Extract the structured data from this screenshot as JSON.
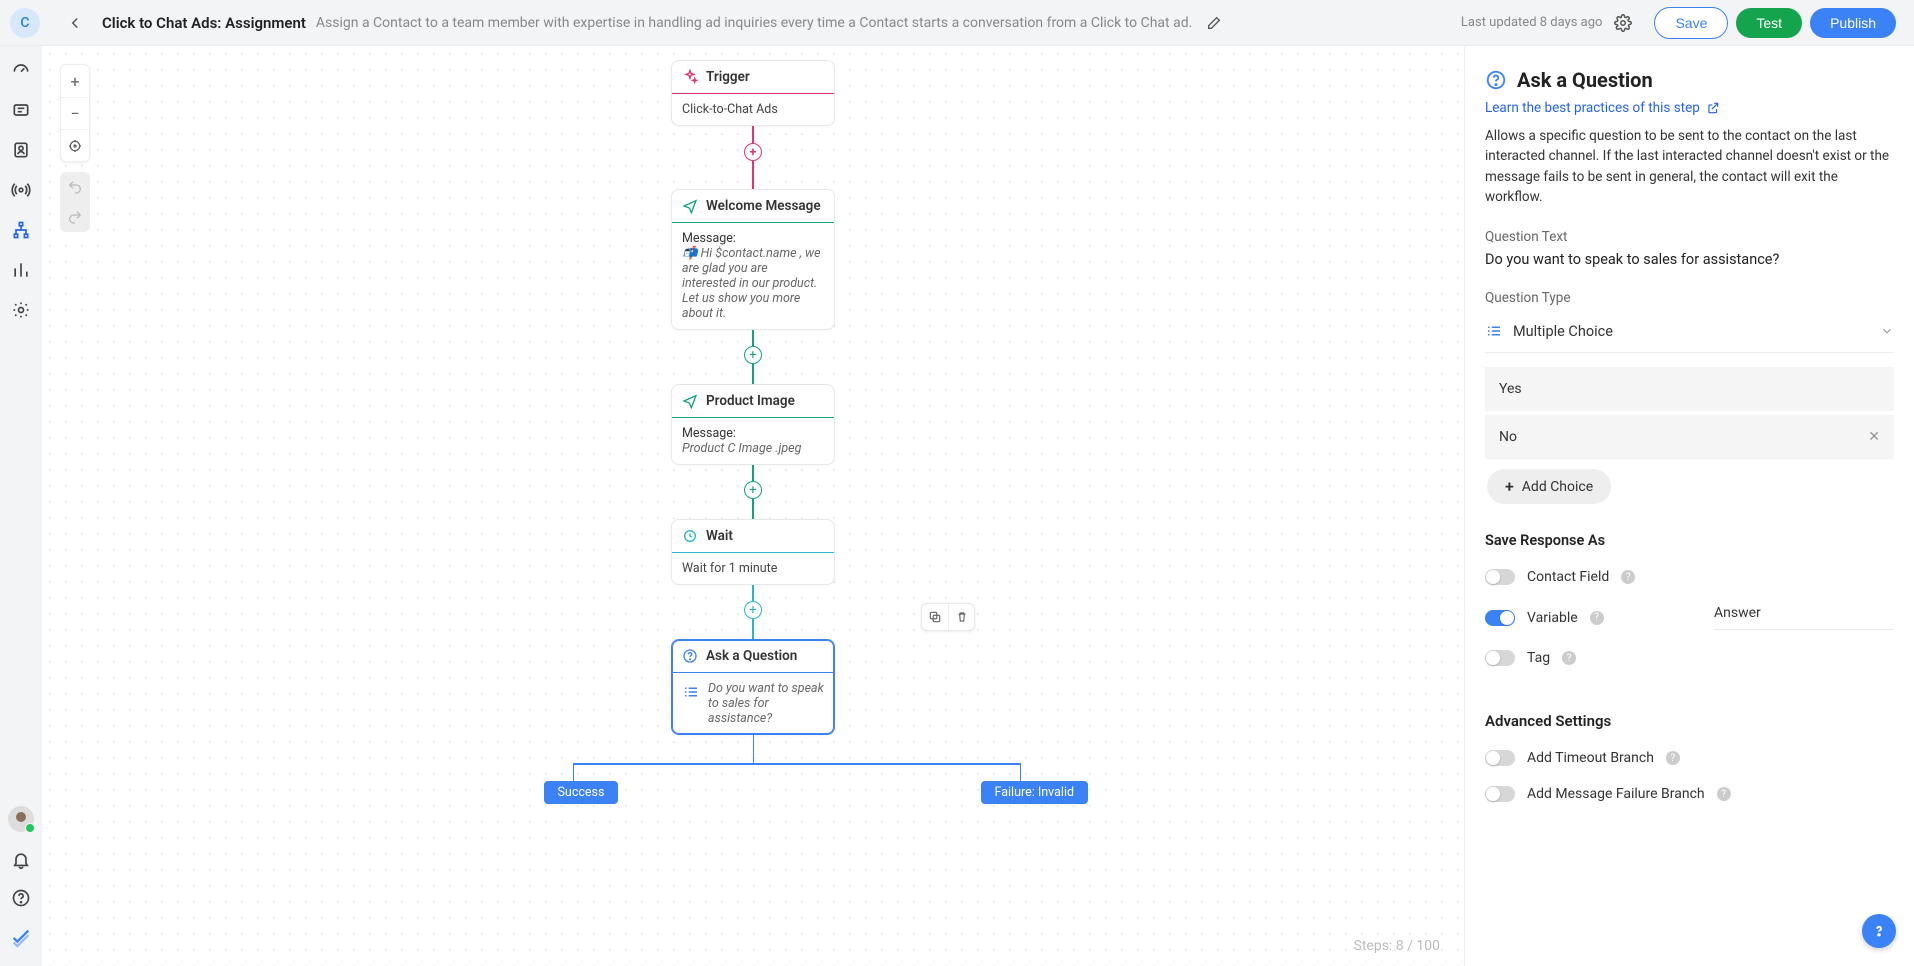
{
  "header": {
    "avatar_letter": "C",
    "title": "Click to Chat Ads: Assignment",
    "subtitle": "Assign a Contact to a team member with expertise in handling ad inquiries every time a Contact starts a conversation from a Click to Chat ad.",
    "last_updated": "Last updated 8 days ago",
    "save_label": "Save",
    "test_label": "Test",
    "publish_label": "Publish"
  },
  "flow": {
    "trigger": {
      "title": "Trigger",
      "body": "Click-to-Chat Ads"
    },
    "welcome": {
      "title": "Welcome Message",
      "label": "Message:",
      "body": "📬 Hi $contact.name , we are glad you are interested in our product. Let us show you more about it."
    },
    "product": {
      "title": "Product Image",
      "label": "Message:",
      "body": "Product C Image .jpeg"
    },
    "wait": {
      "title": "Wait",
      "body": "Wait for 1 minute"
    },
    "question": {
      "title": "Ask a Question",
      "body": "Do you want to speak to sales for assistance?"
    },
    "branches": {
      "success": "Success",
      "failure": "Failure: Invalid"
    },
    "steps_counter": "Steps: 8 / 100"
  },
  "panel": {
    "title": "Ask a Question",
    "learn_link": "Learn the best practices of this step",
    "description": "Allows a specific question to be sent to the contact on the last interacted channel. If the last interacted channel doesn't exist or the message fails to be sent in general, the contact will exit the workflow.",
    "question_text_label": "Question Text",
    "question_text": "Do you want to speak to sales for assistance?",
    "question_type_label": "Question Type",
    "question_type_value": "Multiple Choice",
    "choices": {
      "a": "Yes",
      "b": "No"
    },
    "add_choice": "Add Choice",
    "save_response_as": "Save Response As",
    "contact_field": "Contact Field",
    "variable_label": "Variable",
    "variable_value": "Answer",
    "tag_label": "Tag",
    "advanced_settings": "Advanced Settings",
    "add_timeout": "Add Timeout Branch",
    "add_failure": "Add Message Failure Branch"
  }
}
